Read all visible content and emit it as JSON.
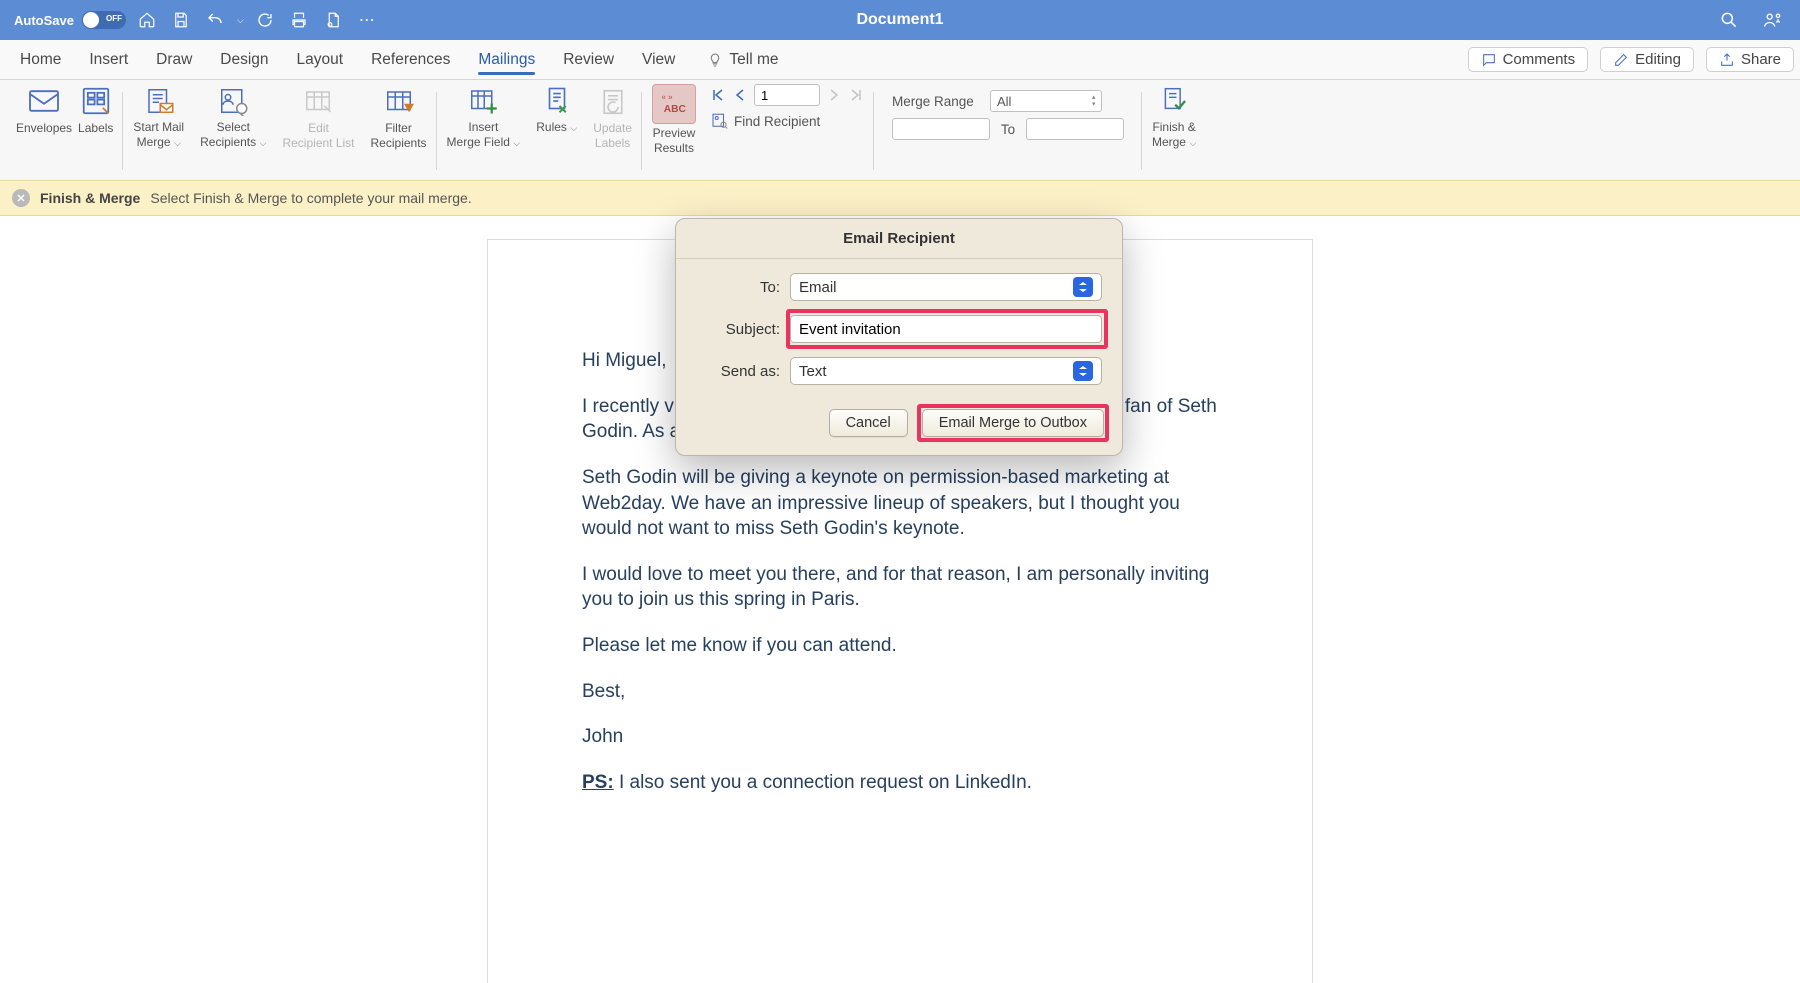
{
  "title_bar": {
    "autosave_label": "AutoSave",
    "autosave_state": "OFF",
    "document_title": "Document1"
  },
  "tabs": {
    "items": [
      "Home",
      "Insert",
      "Draw",
      "Design",
      "Layout",
      "References",
      "Mailings",
      "Review",
      "View"
    ],
    "active_index": 6,
    "tell_me": "Tell me"
  },
  "top_right": {
    "comments": "Comments",
    "editing": "Editing",
    "share": "Share"
  },
  "ribbon": {
    "envelopes": "Envelopes",
    "labels": "Labels",
    "start_mail_merge_l1": "Start Mail",
    "start_mail_merge_l2": "Merge",
    "select_recipients_l1": "Select",
    "select_recipients_l2": "Recipients",
    "edit_recipient_list_l1": "Edit",
    "edit_recipient_list_l2": "Recipient List",
    "filter_recipients_l1": "Filter",
    "filter_recipients_l2": "Recipients",
    "insert_merge_field_l1": "Insert",
    "insert_merge_field_l2": "Merge Field",
    "rules": "Rules",
    "update_labels_l1": "Update",
    "update_labels_l2": "Labels",
    "preview_results_l1": "Preview",
    "preview_results_l2": "Results",
    "record_number": "1",
    "find_recipient": "Find Recipient",
    "merge_range_label": "Merge Range",
    "merge_range_value": "All",
    "to_label": "To",
    "finish_merge_l1": "Finish &",
    "finish_merge_l2": "Merge"
  },
  "info_bar": {
    "title": "Finish & Merge",
    "text": "Select Finish & Merge to complete your mail merge."
  },
  "document": {
    "greeting": "Hi Miguel,",
    "p1": "I recently visited your LinkedIn profile and noticed that you are a fan of Seth Godin. As a fellow fan, I wanted to share this invitation with you.",
    "p2": "Seth Godin will be giving a keynote on permission-based marketing at Web2day. We have an impressive lineup of speakers, but I thought you would not want to miss Seth Godin's keynote.",
    "p3": "I would love to meet you there, and for that reason, I am personally inviting you to join us this spring in Paris.",
    "p4": "Please let me know if you can attend.",
    "signoff": "Best,",
    "name": "John",
    "ps_label": "PS:",
    "ps_text": " I also sent you a connection request on LinkedIn."
  },
  "dialog": {
    "title": "Email Recipient",
    "to_label": "To:",
    "to_value": "Email",
    "subject_label": "Subject:",
    "subject_value": "Event invitation",
    "sendas_label": "Send as:",
    "sendas_value": "Text",
    "cancel": "Cancel",
    "confirm": "Email Merge to Outbox"
  }
}
